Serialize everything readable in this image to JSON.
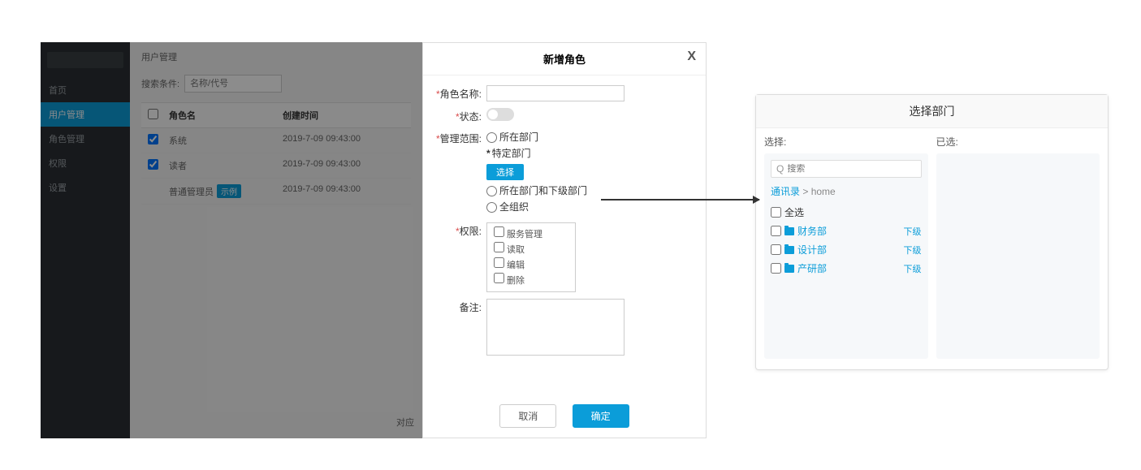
{
  "sidebar": {
    "items": [
      "首页",
      "用户管理",
      "角色管理",
      "权限",
      "设置"
    ],
    "activeIndex": 1
  },
  "main": {
    "pageTitle": "用户管理",
    "filterLabel": "搜索条件:",
    "filterPlaceholder": "名称/代号",
    "columns": {
      "name": "角色名",
      "time": "创建时间"
    },
    "rows": [
      {
        "name": "系统",
        "time": "2019-7-09 09:43:00"
      },
      {
        "name": "读者",
        "time": "2019-7-09 09:43:00"
      },
      {
        "name": "普通管理员",
        "time": "2019-7-09 09:43:00",
        "badge": "示例"
      }
    ],
    "bottomLabel": "对应"
  },
  "modal": {
    "title": "新增角色",
    "close": "X",
    "labels": {
      "name": "角色名称:",
      "status": "状态:",
      "scope": "管理范围:",
      "perm": "权限:",
      "remark": "备注:"
    },
    "scope": {
      "opt1": "所在部门",
      "opt2": "特定部门",
      "selectBtn": "选择",
      "opt3": "所在部门和下级部门",
      "opt4": "全组织"
    },
    "perm": {
      "p1": "服务管理",
      "p2": "读取",
      "p3": "编辑",
      "p4": "删除"
    },
    "buttons": {
      "cancel": "取消",
      "confirm": "确定"
    }
  },
  "dept": {
    "title": "选择部门",
    "leftLabel": "选择:",
    "rightLabel": "已选:",
    "searchPlaceholder": "搜索",
    "crumbRoot": "通讯录",
    "crumbSep": "> home",
    "selectAll": "全选",
    "items": [
      {
        "name": "财务部",
        "action": "下级"
      },
      {
        "name": "设计部",
        "action": "下级"
      },
      {
        "name": "产研部",
        "action": "下级"
      }
    ]
  }
}
